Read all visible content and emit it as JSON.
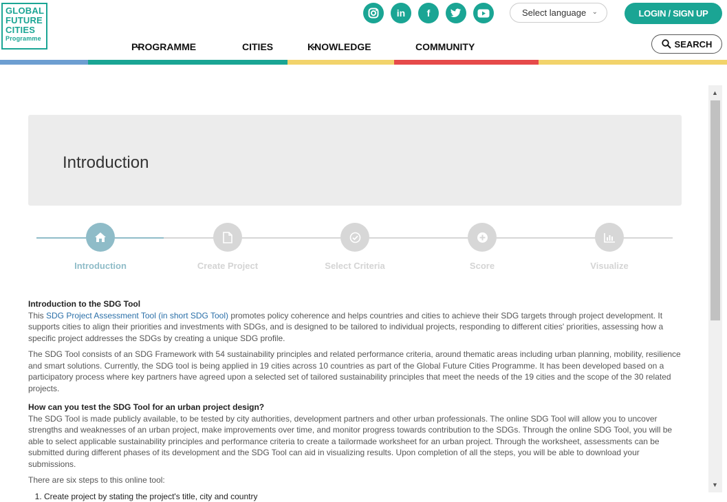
{
  "logo": {
    "lines": [
      "GLOBAL",
      "FUTURE",
      "CITIES",
      "Programme"
    ]
  },
  "social": [
    {
      "icon": "instagram-icon",
      "glyph": "◎"
    },
    {
      "icon": "linkedin-icon",
      "glyph": "in"
    },
    {
      "icon": "facebook-icon",
      "glyph": "f"
    },
    {
      "icon": "twitter-icon",
      "glyph": "🐦"
    },
    {
      "icon": "youtube-icon",
      "glyph": "▶"
    }
  ],
  "language": {
    "label": "Select language"
  },
  "login": {
    "label": "LOGIN / SIGN UP"
  },
  "nav": {
    "programme": "PROGRAMME",
    "cities": "CITIES",
    "knowledge": "KNOWLEDGE",
    "community": "COMMUNITY"
  },
  "search": {
    "label": "SEARCH"
  },
  "colors": {
    "accent": "#1aa594",
    "step_active": "#8fbcc8",
    "step_inactive": "#d7d7d7"
  },
  "intro": {
    "title": "Introduction"
  },
  "steps": [
    {
      "label": "Introduction",
      "icon": "home-icon",
      "active": true
    },
    {
      "label": "Create Project",
      "icon": "document-icon",
      "active": false
    },
    {
      "label": "Select Criteria",
      "icon": "check-circle-icon",
      "active": false
    },
    {
      "label": "Score",
      "icon": "plus-circle-icon",
      "active": false
    },
    {
      "label": "Visualize",
      "icon": "bar-chart-icon",
      "active": false
    }
  ],
  "section1": {
    "heading": "Introduction to the SDG Tool",
    "p1_pre": "This ",
    "p1_link": "SDG Project Assessment Tool (in short SDG Tool)",
    "p1_post": " promotes policy coherence and helps countries and cities to achieve their SDG targets through project development. It supports cities to align their priorities and investments with SDGs, and is designed to be tailored to individual projects, responding to different cities' priorities, assessing how a specific project addresses the SDGs by creating a unique SDG profile.",
    "p2": "The SDG Tool consists of an SDG Framework with 54 sustainability principles and related performance criteria, around thematic areas including urban planning, mobility, resilience and smart solutions. Currently, the SDG tool is being applied in 19 cities across 10 countries as part of the Global Future Cities Programme. It has been developed based on a participatory process where key partners have agreed upon a selected set of tailored sustainability principles that meet the needs of the 19 cities and the scope of the 30 related projects."
  },
  "section2": {
    "heading": "How can you test the SDG Tool for an urban project design?",
    "p1": "The SDG Tool is made publicly available, to be tested by city authorities, development partners and other urban professionals. The online SDG Tool will allow you to uncover strengths and weaknesses of an urban project, make improvements over time, and monitor progress towards contribution to the SDGs. Through the online SDG Tool, you will be able to select applicable sustainability principles and performance criteria to create a tailormade worksheet for an urban project. Through the worksheet, assessments can be submitted during different phases of its development and the SDG Tool can aid in visualizing results. Upon completion of all the steps, you will be able to download your submissions.",
    "p2": "There are six steps to this online tool:",
    "list": [
      "Create project by stating the project's title, city and country"
    ]
  }
}
